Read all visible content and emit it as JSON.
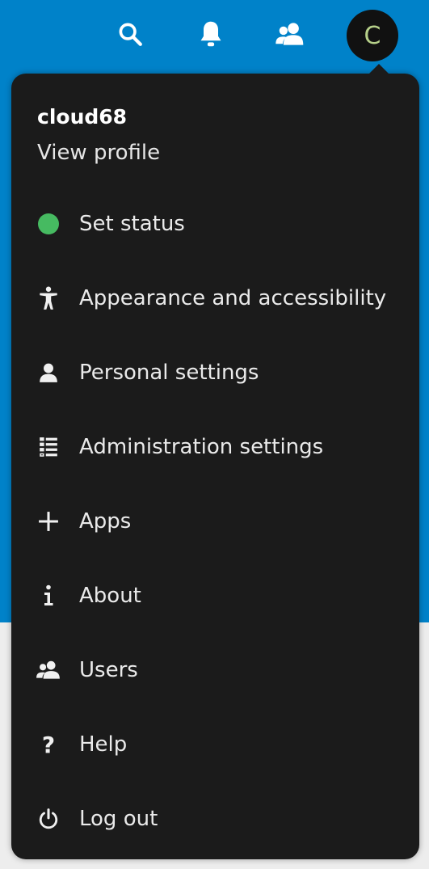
{
  "header": {
    "icons": [
      "search-icon",
      "bell-icon",
      "contacts-icon"
    ],
    "avatar_letter": "C",
    "accent_color": "#0082c9"
  },
  "menu": {
    "username": "cloud68",
    "view_profile": "View profile",
    "items": [
      {
        "label": "Set status",
        "icon": "status-dot-icon",
        "status_color": "#46ba61"
      },
      {
        "label": "Appearance and accessibility",
        "icon": "accessibility-icon"
      },
      {
        "label": "Personal settings",
        "icon": "user-icon"
      },
      {
        "label": "Administration settings",
        "icon": "list-icon"
      },
      {
        "label": "Apps",
        "icon": "plus-icon"
      },
      {
        "label": "About",
        "icon": "info-icon"
      },
      {
        "label": "Users",
        "icon": "users-icon"
      },
      {
        "label": "Help",
        "icon": "help-icon"
      },
      {
        "label": "Log out",
        "icon": "power-icon"
      }
    ]
  }
}
